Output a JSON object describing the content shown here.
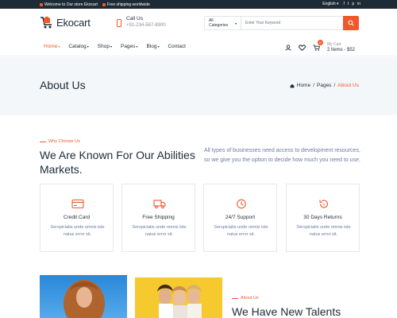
{
  "topbar": {
    "welcome": "Welcome to Our store Ekocart",
    "shipping": "Free shipping worldwide",
    "language": "English",
    "social": [
      "f",
      "t",
      "p",
      "in"
    ]
  },
  "header": {
    "logo": "Ekocart",
    "call_title": "Call Us",
    "call_number": "+91-234-567-8900",
    "search_category": "All Categories",
    "search_placeholder": "Enter Your Keyword"
  },
  "nav": {
    "items": [
      {
        "label": "Home"
      },
      {
        "label": "Catalog"
      },
      {
        "label": "Shop"
      },
      {
        "label": "Pages"
      },
      {
        "label": "Blog"
      },
      {
        "label": "Contact"
      }
    ],
    "cart_count": "0",
    "cart_label": "My Cart",
    "cart_summary": "2 Items - $52"
  },
  "banner": {
    "title": "About Us",
    "breadcrumb": [
      "Home",
      "/",
      "Pages",
      "/",
      "About Us"
    ]
  },
  "why": {
    "eyebrow": "Why Choose Us",
    "heading": "We Are Known For Our Abilities Markets.",
    "intro": "All types of businesses need access to development resources, so we give you the option to decide how much you need to use."
  },
  "features": [
    {
      "title": "Credit Card",
      "desc": "Serspiciatis unde omnis iste natus error sit.",
      "icon": "credit-card-icon"
    },
    {
      "title": "Free Shipping",
      "desc": "Serspiciatis unde omnis iste natus error sit.",
      "icon": "truck-icon"
    },
    {
      "title": "24/7 Support",
      "desc": "Serspiciatis unde omnis iste natus error sit.",
      "icon": "clock-icon"
    },
    {
      "title": "30 Days Returns",
      "desc": "Serspiciatis unde omnis iste natus error sit.",
      "icon": "return-icon"
    }
  ],
  "about": {
    "eyebrow": "About Us",
    "heading": "We Have New Talents"
  },
  "colors": {
    "accent": "#f0582a",
    "dark": "#1d2b36",
    "muted": "#6b7aa3",
    "band": "#f4f7fa"
  }
}
